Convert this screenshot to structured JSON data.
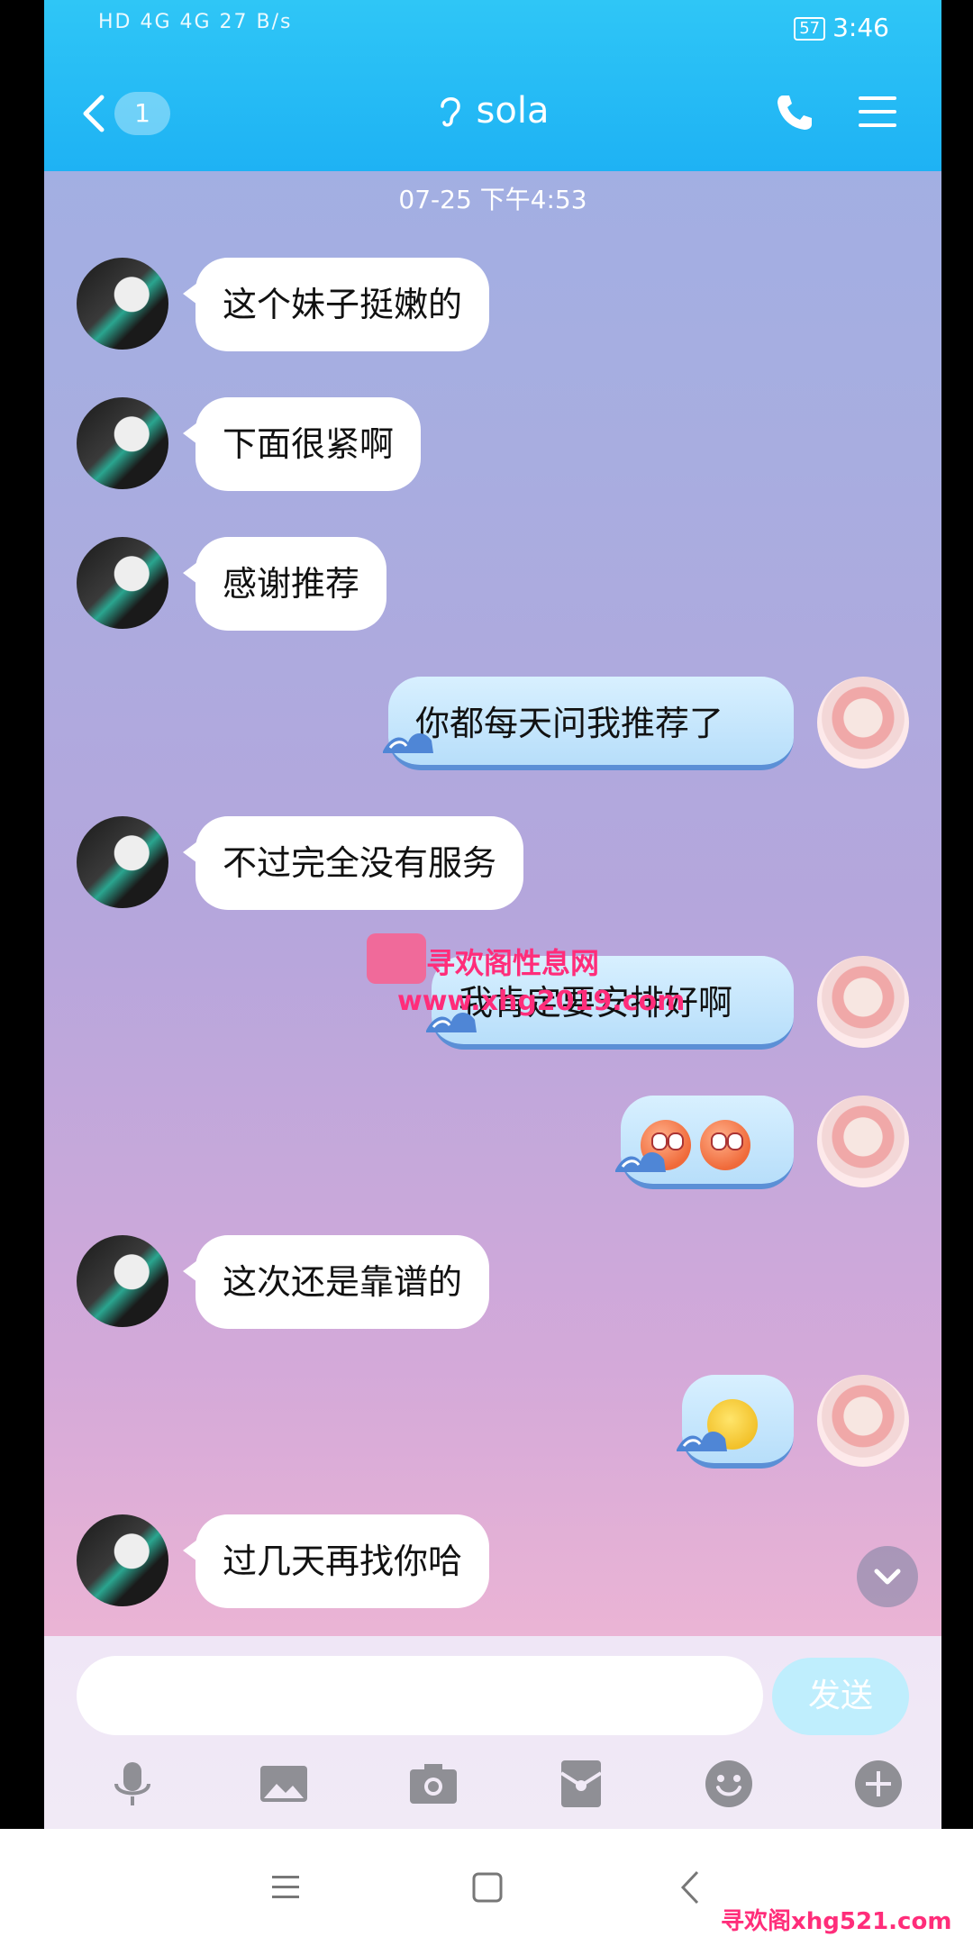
{
  "status_bar": {
    "left_text": "HD 4G 4G 27 B/s",
    "battery": "57",
    "time": "3:46"
  },
  "header": {
    "unread_count": "1",
    "contact_name": "sola"
  },
  "timestamp": "07-25 下午4:53",
  "messages": [
    {
      "side": "left",
      "text": "这个妹子挺嫩的"
    },
    {
      "side": "left",
      "text": "下面很紧啊"
    },
    {
      "side": "left",
      "text": "感谢推荐"
    },
    {
      "side": "right",
      "text": "你都每天问我推荐了"
    },
    {
      "side": "left",
      "text": "不过完全没有服务"
    },
    {
      "side": "right",
      "text": "我肯定要安排好啊"
    },
    {
      "side": "right",
      "emoji": [
        "eye-roll-emoji",
        "eye-roll-emoji"
      ]
    },
    {
      "side": "left",
      "text": "这次还是靠谱的"
    },
    {
      "side": "right",
      "emoji": [
        "sweat-emoji"
      ]
    },
    {
      "side": "left",
      "text": "过几天再找你哈"
    }
  ],
  "input": {
    "placeholder": "",
    "send_label": "发送"
  },
  "toolbar_icons": [
    "microphone-icon",
    "image-icon",
    "camera-icon",
    "red-packet-icon",
    "emoji-icon",
    "plus-icon"
  ],
  "watermarks": {
    "center_title": "寻欢阁性息网",
    "center_url": "www.xhg2019.com",
    "bottom_right": "寻欢阁xhg521.com"
  },
  "colors": {
    "header": "#1eb2f4",
    "send_button": "#bfeefd",
    "self_bubble": "#c7e6fb"
  }
}
